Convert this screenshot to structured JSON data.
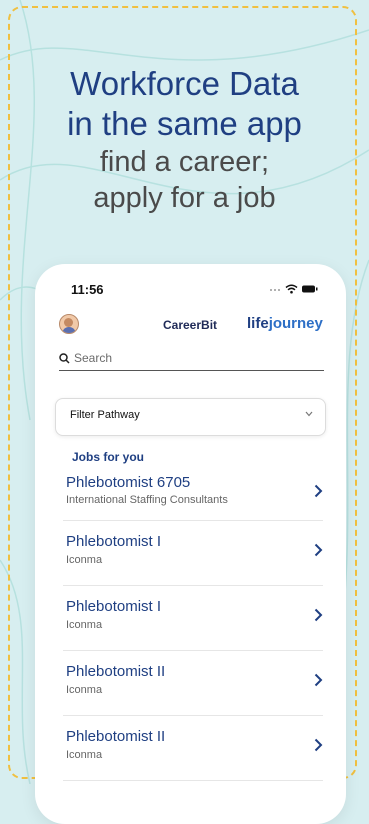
{
  "headline": {
    "line1": "Workforce Data",
    "line2": "in the same app",
    "line3": "find a career;",
    "line4": "apply for a job"
  },
  "status_bar": {
    "time": "11:56"
  },
  "app_header": {
    "brand": "CareerBit",
    "logo_part1": "life",
    "logo_part2": "journey"
  },
  "search": {
    "placeholder": "Search"
  },
  "filter": {
    "label": "Filter Pathway"
  },
  "jobs": {
    "section_title": "Jobs for you",
    "items": [
      {
        "title": "Phlebotomist 6705",
        "company": "International Staffing Consultants"
      },
      {
        "title": "Phlebotomist I",
        "company": "Iconma"
      },
      {
        "title": "Phlebotomist I",
        "company": "Iconma"
      },
      {
        "title": "Phlebotomist II",
        "company": "Iconma"
      },
      {
        "title": "Phlebotomist II",
        "company": "Iconma"
      }
    ]
  },
  "colors": {
    "accent": "#1f3f82",
    "frame": "#f0c040",
    "background": "#d7eef0"
  }
}
